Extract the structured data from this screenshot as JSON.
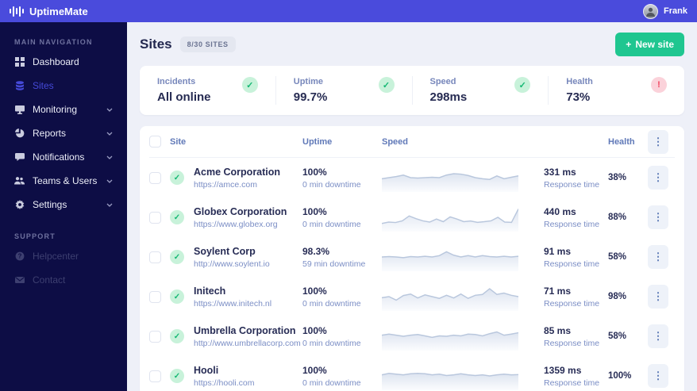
{
  "app": {
    "name": "UptimeMate",
    "user_name": "Frank"
  },
  "icons": {
    "plus": "+",
    "dots": "⋮",
    "check": "✓",
    "alert": "!"
  },
  "colors": {
    "topbar": "#4a4bdc",
    "sidebar": "#0d0d45",
    "accent": "#4549d8",
    "green": "#1fc690",
    "ok_bg": "#c8f2da",
    "ok_fg": "#14b873",
    "alert_bg": "#fbd2da",
    "alert_fg": "#f0455f",
    "content_bg": "#eef0f8"
  },
  "sidebar": {
    "main_label": "MAIN NAVIGATION",
    "support_label": "SUPPORT",
    "items": [
      {
        "label": "Dashboard",
        "icon": "dashboard-icon",
        "chevron": false,
        "active": false
      },
      {
        "label": "Sites",
        "icon": "sites-icon",
        "chevron": false,
        "active": true
      },
      {
        "label": "Monitoring",
        "icon": "monitoring-icon",
        "chevron": true,
        "active": false
      },
      {
        "label": "Reports",
        "icon": "reports-icon",
        "chevron": true,
        "active": false
      },
      {
        "label": "Notifications",
        "icon": "notifications-icon",
        "chevron": true,
        "active": false
      },
      {
        "label": "Teams & Users",
        "icon": "teams-icon",
        "chevron": true,
        "active": false
      },
      {
        "label": "Settings",
        "icon": "settings-icon",
        "chevron": true,
        "active": false
      }
    ],
    "support_items": [
      {
        "label": "Helpcenter",
        "icon": "help-icon"
      },
      {
        "label": "Contact",
        "icon": "mail-icon"
      }
    ]
  },
  "page": {
    "title": "Sites",
    "badge": "8/30 SITES",
    "new_site_label": "New site"
  },
  "stats": [
    {
      "label": "Incidents",
      "value": "All online",
      "status": "ok"
    },
    {
      "label": "Uptime",
      "value": "99.7%",
      "status": "ok"
    },
    {
      "label": "Speed",
      "value": "298ms",
      "status": "ok"
    },
    {
      "label": "Health",
      "value": "73%",
      "status": "alert"
    }
  ],
  "table": {
    "headers": {
      "site": "Site",
      "uptime": "Uptime",
      "speed": "Speed",
      "health": "Health"
    },
    "response_label": "Response time",
    "rows": [
      {
        "name": "Acme Corporation",
        "url": "https://amce.com",
        "uptime": "100%",
        "downtime": "0 min downtime",
        "response": "331 ms",
        "health": "38%",
        "sparkline": [
          0.45,
          0.5,
          0.55,
          0.62,
          0.5,
          0.48,
          0.5,
          0.52,
          0.5,
          0.62,
          0.68,
          0.66,
          0.6,
          0.5,
          0.45,
          0.42,
          0.58,
          0.45,
          0.52,
          0.58
        ]
      },
      {
        "name": "Globex Corporation",
        "url": "https://www.globex.org",
        "uptime": "100%",
        "downtime": "0 min downtime",
        "response": "440 ms",
        "health": "88%",
        "sparkline": [
          0.22,
          0.28,
          0.26,
          0.34,
          0.56,
          0.44,
          0.34,
          0.28,
          0.42,
          0.3,
          0.52,
          0.42,
          0.3,
          0.33,
          0.27,
          0.3,
          0.34,
          0.5,
          0.28,
          0.27,
          0.88
        ]
      },
      {
        "name": "Soylent Corp",
        "url": "http://www.soylent.io",
        "uptime": "98.3%",
        "downtime": "59 min downtime",
        "response": "91 ms",
        "health": "58%",
        "sparkline": [
          0.5,
          0.52,
          0.5,
          0.47,
          0.52,
          0.5,
          0.53,
          0.5,
          0.56,
          0.74,
          0.58,
          0.5,
          0.56,
          0.5,
          0.56,
          0.52,
          0.5,
          0.53,
          0.5,
          0.53
        ]
      },
      {
        "name": "Initech",
        "url": "https://www.initech.nl",
        "uptime": "100%",
        "downtime": "0 min downtime",
        "response": "71 ms",
        "health": "98%",
        "sparkline": [
          0.45,
          0.5,
          0.34,
          0.55,
          0.62,
          0.44,
          0.58,
          0.5,
          0.42,
          0.56,
          0.44,
          0.62,
          0.42,
          0.56,
          0.6,
          0.86,
          0.6,
          0.66,
          0.56,
          0.5
        ]
      },
      {
        "name": "Umbrella Corporation",
        "url": "http://www.umbrellacorp.com",
        "uptime": "100%",
        "downtime": "0 min downtime",
        "response": "85 ms",
        "health": "58%",
        "sparkline": [
          0.55,
          0.6,
          0.55,
          0.5,
          0.55,
          0.58,
          0.52,
          0.45,
          0.52,
          0.5,
          0.55,
          0.52,
          0.6,
          0.58,
          0.52,
          0.62,
          0.7,
          0.55,
          0.6,
          0.66
        ]
      },
      {
        "name": "Hooli",
        "url": "https://hooli.com",
        "uptime": "100%",
        "downtime": "0 min downtime",
        "response": "1359 ms",
        "health": "100%",
        "sparkline": [
          0.55,
          0.62,
          0.58,
          0.55,
          0.6,
          0.62,
          0.6,
          0.55,
          0.58,
          0.52,
          0.55,
          0.6,
          0.55,
          0.52,
          0.55,
          0.5,
          0.55,
          0.58,
          0.55,
          0.56
        ]
      }
    ]
  }
}
